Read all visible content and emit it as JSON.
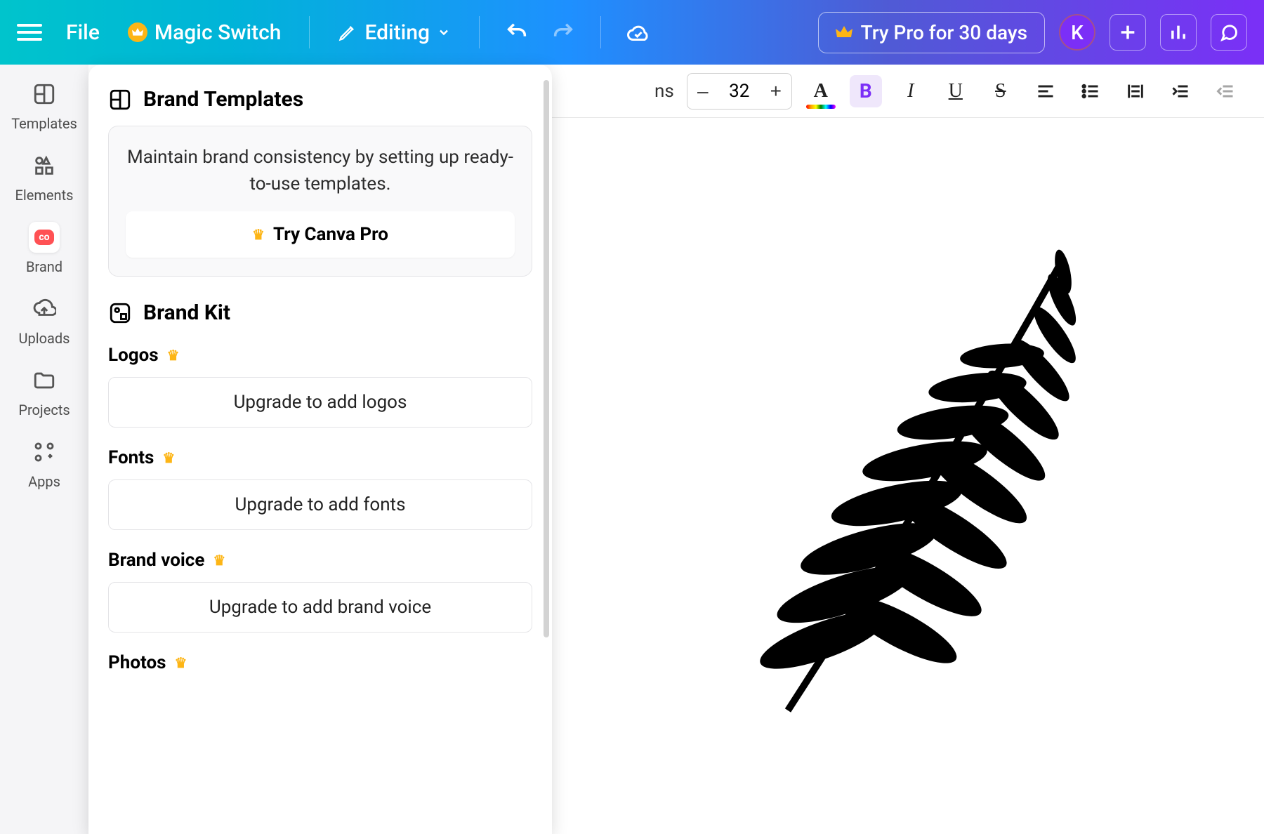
{
  "topbar": {
    "file": "File",
    "magic_switch": "Magic Switch",
    "editing": "Editing",
    "try_pro": "Try Pro for 30 days",
    "avatar_initial": "K"
  },
  "leftrail": {
    "templates": "Templates",
    "elements": "Elements",
    "brand": "Brand",
    "brand_badge": "co",
    "uploads": "Uploads",
    "projects": "Projects",
    "apps": "Apps"
  },
  "panel": {
    "brand_templates_title": "Brand Templates",
    "brand_consistency_text": "Maintain brand consistency by setting up ready-to-use templates.",
    "try_canva_pro": "Try Canva Pro",
    "brand_kit_title": "Brand Kit",
    "logos_label": "Logos",
    "logos_cta": "Upgrade to add logos",
    "fonts_label": "Fonts",
    "fonts_cta": "Upgrade to add fonts",
    "brand_voice_label": "Brand voice",
    "brand_voice_cta": "Upgrade to add brand voice",
    "photos_label": "Photos"
  },
  "text_toolbar": {
    "font_dropdown_partial": "ns",
    "font_size": "32",
    "bold": "B",
    "italic": "I",
    "underline": "U",
    "strike": "S",
    "letter_a": "A"
  }
}
